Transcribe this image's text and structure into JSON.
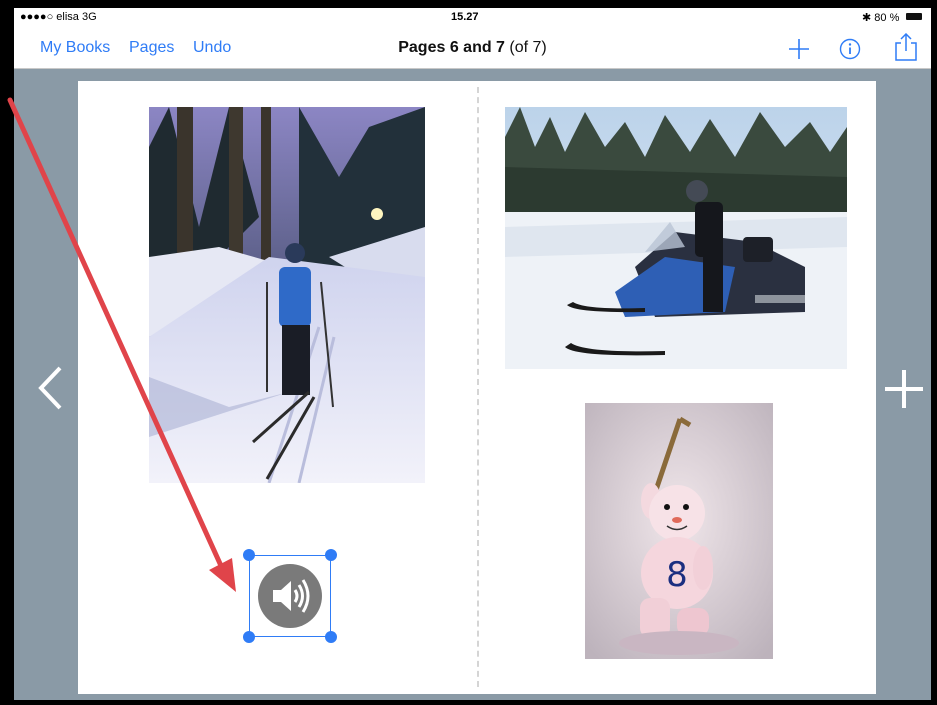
{
  "status": {
    "carrier": "●●●●○ elisa  3G",
    "time": "15.27",
    "battery": "✱ 80 %"
  },
  "nav": {
    "my_books": "My Books",
    "pages": "Pages",
    "undo": "Undo",
    "title_bold": "Pages 6 and 7",
    "title_rest": "(of 7)"
  },
  "icons": {
    "add": "plus-icon",
    "info": "info-icon",
    "share": "share-icon",
    "prev": "chevron-left-icon",
    "next_add": "plus-icon",
    "audio": "speaker-icon"
  },
  "colors": {
    "accent": "#2f7cf6",
    "background": "#8a9aa6",
    "annotation_arrow": "#e0444a"
  }
}
